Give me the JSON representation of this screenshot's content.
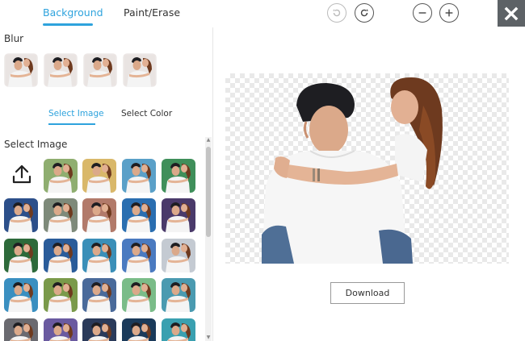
{
  "tabs": [
    {
      "label": "Background",
      "active": true
    },
    {
      "label": "Paint/Erase",
      "active": false
    }
  ],
  "toolbar": {
    "undo_icon": "undo-icon",
    "redo_icon": "redo-icon",
    "zoom_out_icon": "minus-icon",
    "zoom_in_icon": "plus-icon",
    "close_icon": "close-icon"
  },
  "blur": {
    "label": "Blur",
    "thumb_count": 4
  },
  "subtabs": [
    {
      "label": "Select Image",
      "active": true
    },
    {
      "label": "Select Color",
      "active": false
    }
  ],
  "select_image": {
    "label": "Select Image",
    "upload_icon": "upload-icon",
    "backgrounds": [
      "#8fae70",
      "#d9b86a",
      "#5aa0c8",
      "#3f8f5a",
      "#2c4f8a",
      "#7e8a7a",
      "#b27a6a",
      "#2a6eb0",
      "#4a3a6a",
      "#2d6a3a",
      "#2a5c9a",
      "#3a8fb8",
      "#4a7ac0",
      "#c4cad2",
      "#3a8fc0",
      "#7a9a4a",
      "#4a6a9a",
      "#7abc88",
      "#4a9ab0",
      "#6a6a70",
      "#6a5aa0",
      "#2a3a5a",
      "#1a3a5a",
      "#3aa0b0"
    ]
  },
  "download": {
    "label": "Download"
  },
  "colors": {
    "accent": "#2ea3dd",
    "close_bg": "#5d6266"
  }
}
